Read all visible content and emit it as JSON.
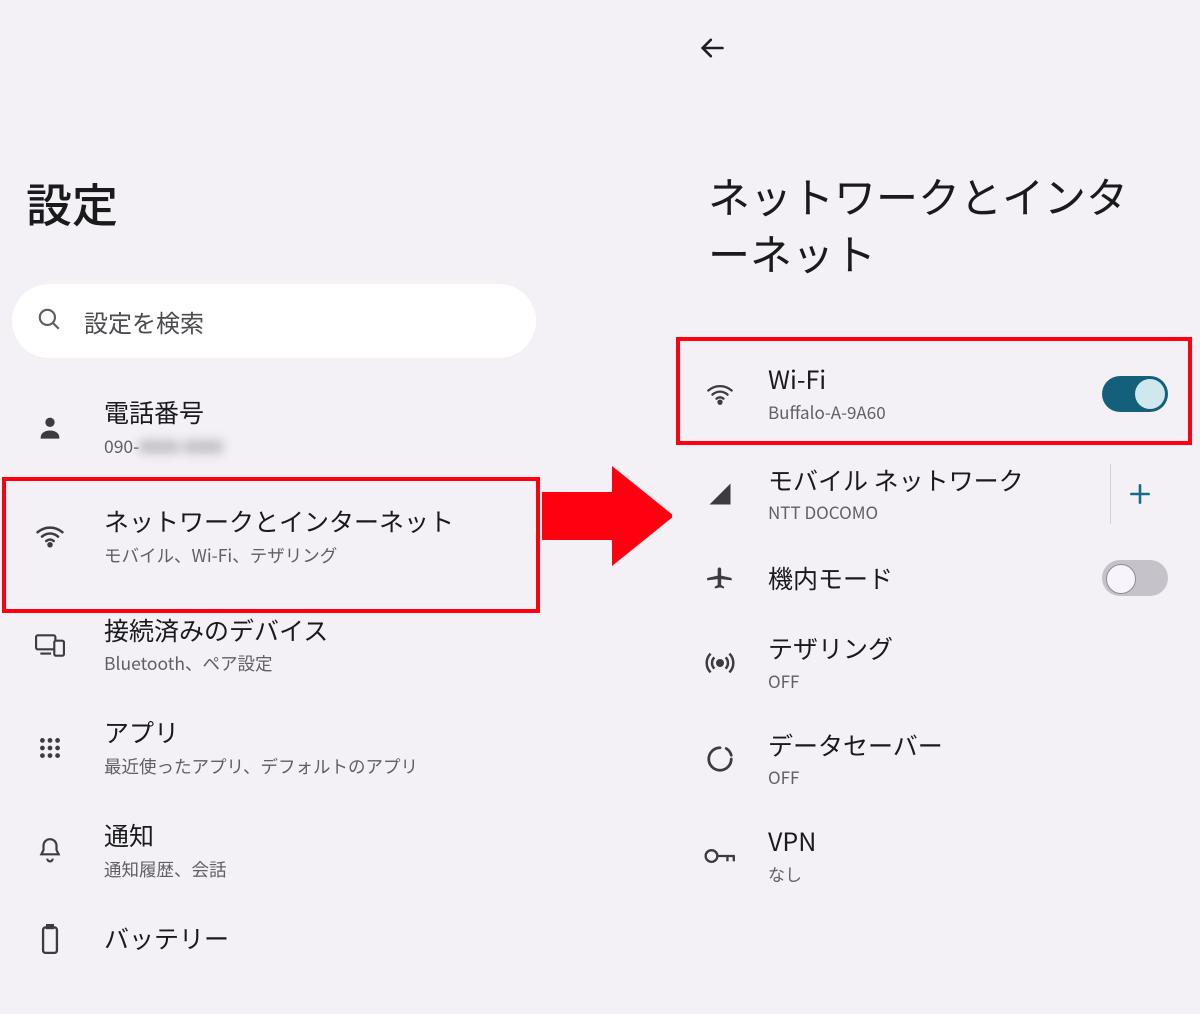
{
  "colors": {
    "highlight_red": "#ff0010",
    "accent_teal": "#14607a"
  },
  "left": {
    "title": "設定",
    "search_placeholder": "設定を検索",
    "items": [
      {
        "icon": "person",
        "title": "電話番号",
        "sub_prefix": "090-",
        "sub_blurred": "0000-0000"
      },
      {
        "icon": "wifi",
        "title": "ネットワークとインターネット",
        "sub": "モバイル、Wi-Fi、テザリング",
        "highlight": true
      },
      {
        "icon": "devices",
        "title": "接続済みのデバイス",
        "sub": "Bluetooth、ペア設定"
      },
      {
        "icon": "apps",
        "title": "アプリ",
        "sub": "最近使ったアプリ、デフォルトのアプリ"
      },
      {
        "icon": "bell",
        "title": "通知",
        "sub": "通知履歴、会話"
      },
      {
        "icon": "battery",
        "title": "バッテリー",
        "sub": ""
      }
    ]
  },
  "right": {
    "page_title": "ネットワークとインターネット",
    "items": [
      {
        "icon": "wifi",
        "title": "Wi-Fi",
        "sub": "Buffalo-A-9A60",
        "control": "switch-on",
        "highlight": true
      },
      {
        "icon": "signal",
        "title": "モバイル ネットワーク",
        "sub": "NTT DOCOMO",
        "control": "plus"
      },
      {
        "icon": "plane",
        "title": "機内モード",
        "sub": "",
        "control": "switch-off"
      },
      {
        "icon": "hotspot",
        "title": "テザリング",
        "sub": "OFF"
      },
      {
        "icon": "datasaver",
        "title": "データセーバー",
        "sub": "OFF"
      },
      {
        "icon": "vpn",
        "title": "VPN",
        "sub": "なし"
      }
    ]
  }
}
